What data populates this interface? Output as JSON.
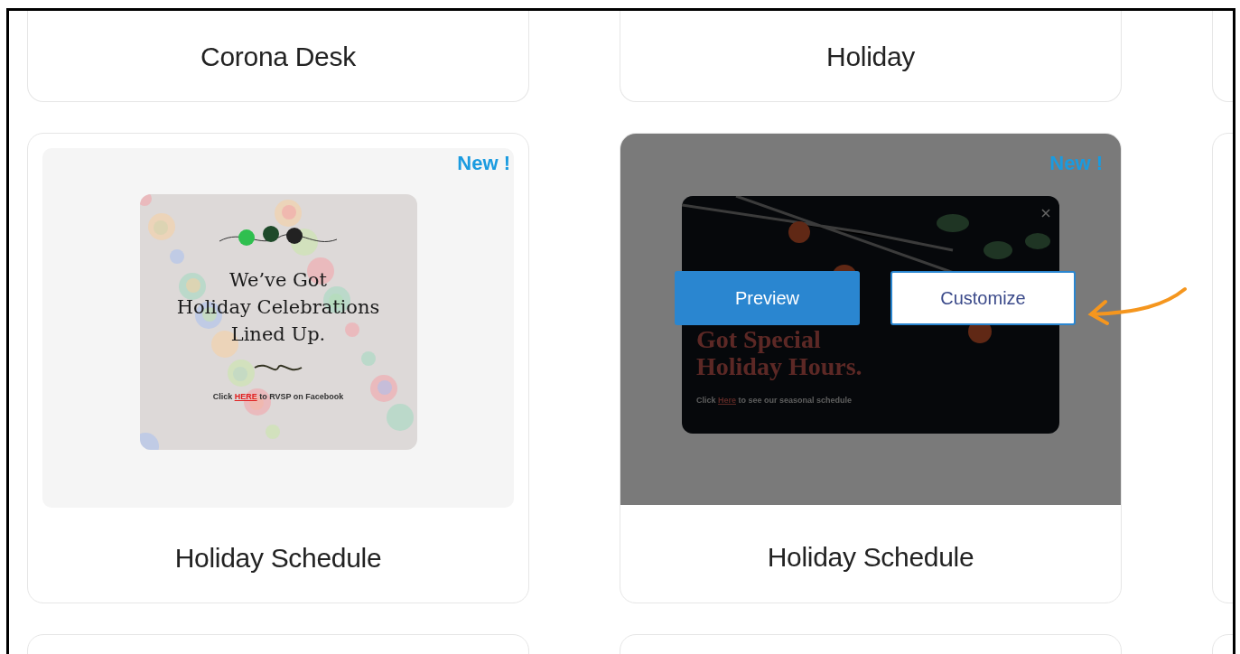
{
  "top_cards": [
    {
      "title": "Corona Desk"
    },
    {
      "title": "Holiday"
    }
  ],
  "templates": [
    {
      "title": "Holiday Schedule",
      "badge": "New !",
      "hovered": false,
      "kind": "light",
      "preview": {
        "headline": [
          "We’ve Got",
          "Holiday Celebrations",
          "Lined Up."
        ],
        "footer_before": "Click ",
        "footer_link": "HERE",
        "footer_after": " to RVSP on Facebook"
      }
    },
    {
      "title": "Holiday Schedule",
      "badge": "New !",
      "hovered": true,
      "kind": "dark",
      "preview": {
        "headline": [
          "Got Special",
          "Holiday Hours."
        ],
        "footer_before": "Click ",
        "footer_link": "Here",
        "footer_after": " to see our seasonal schedule"
      },
      "actions": [
        {
          "label": "Preview",
          "kind": "primary"
        },
        {
          "label": "Customize",
          "kind": "outline"
        }
      ]
    }
  ]
}
